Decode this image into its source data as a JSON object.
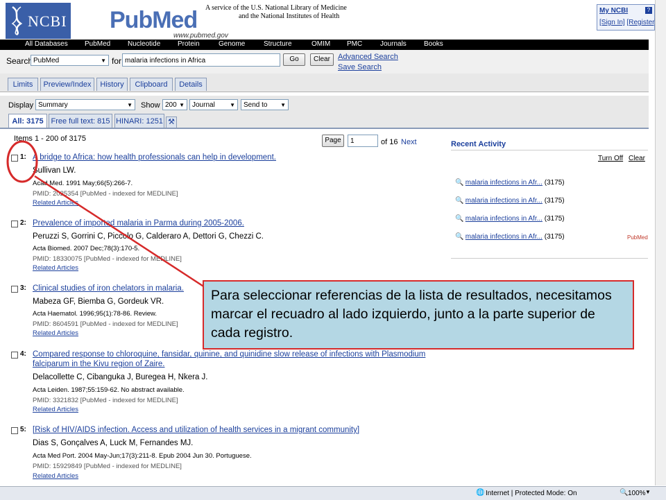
{
  "header": {
    "ncbi_logo_text": "NCBI",
    "pubmed_logo_text": "PubMed",
    "pubmed_url": "www.pubmed.gov",
    "service_line1": "A service of the U.S. National Library of Medicine",
    "service_line2": "and the National Institutes of Health",
    "myncbi_title": "My NCBI",
    "myncbi_help": "?",
    "sign_in": "[Sign In]",
    "register": "[Register]"
  },
  "nav": [
    "All Databases",
    "PubMed",
    "Nucleotide",
    "Protein",
    "Genome",
    "Structure",
    "OMIM",
    "PMC",
    "Journals",
    "Books"
  ],
  "search": {
    "label": "Search",
    "database": "PubMed",
    "for_label": "for",
    "query": "malaria infections in Africa",
    "go": "Go",
    "clear": "Clear",
    "advanced": "Advanced Search",
    "save": "Save Search"
  },
  "tabs": [
    "Limits",
    "Preview/Index",
    "History",
    "Clipboard",
    "Details"
  ],
  "display": {
    "label": "Display",
    "format": "Summary",
    "show_label": "Show",
    "per_page": "200",
    "sort": "Journal",
    "send_to": "Send to"
  },
  "filter_tabs": [
    "All: 3175",
    "Free full text: 815",
    "HINARI: 1251"
  ],
  "pager": {
    "items_text": "Items 1 - 200 of 3175",
    "page_button": "Page",
    "page_value": "1",
    "of_text": "of 16",
    "next": "Next"
  },
  "results": [
    {
      "num": "1:",
      "title": "A bridge to Africa: how health professionals can help in development.",
      "authors": "Sullivan LW.",
      "journal": "Acad Med. 1991 May;66(5):266-7.",
      "pmid": "PMID: 2025354 [PubMed - indexed for MEDLINE]",
      "related": "Related Articles"
    },
    {
      "num": "2:",
      "title": "Prevalence of imported malaria in Parma during 2005-2006.",
      "authors": "Peruzzi S, Gorrini C, Piccolo G, Calderaro A, Dettori G, Chezzi C.",
      "journal": "Acta Biomed. 2007 Dec;78(3):170-5.",
      "pmid": "PMID: 18330075 [PubMed - indexed for MEDLINE]",
      "related": "Related Articles"
    },
    {
      "num": "3:",
      "title": "Clinical studies of iron chelators in malaria.",
      "authors": "Mabeza GF, Biemba G, Gordeuk VR.",
      "journal": "Acta Haematol. 1996;95(1):78-86. Review.",
      "pmid": "PMID: 8604591 [PubMed - indexed for MEDLINE]",
      "related": "Related Articles"
    },
    {
      "num": "4:",
      "title": "Compared response to chloroquine, fansidar, quinine, and quinidine slow release of infections with Plasmodium",
      "title2": "falciparum in the Kivu region of Zaire.",
      "authors": "Delacollette C, Cibanguka J, Buregea H, Nkera J.",
      "journal": "Acta Leiden. 1987;55:159-62. No abstract available.",
      "pmid": "PMID: 3321832 [PubMed - indexed for MEDLINE]",
      "related": "Related Articles"
    },
    {
      "num": "5:",
      "title": "[Risk of HIV/AIDS infection. Access and utilization of health services in a migrant community]",
      "authors": "Dias S, Gonçalves A, Luck M, Fernandes MJ.",
      "journal": "Acta Med Port. 2004 May-Jun;17(3):211-8. Epub 2004 Jun 30. Portuguese.",
      "pmid": "PMID: 15929849 [PubMed - indexed for MEDLINE]",
      "related": "Related Articles"
    }
  ],
  "recent_activity": {
    "title": "Recent Activity",
    "turn_off": "Turn Off",
    "clear": "Clear",
    "items": [
      {
        "query": "malaria infections in Afr...",
        "count": "(3175)",
        "source": ""
      },
      {
        "query": "malaria infections in Afr...",
        "count": "(3175)",
        "source": ""
      },
      {
        "query": "malaria infections in Afr...",
        "count": "(3175)",
        "source": ""
      },
      {
        "query": "malaria infections in Afr...",
        "count": "(3175)",
        "source": "PubMed"
      }
    ]
  },
  "callout_text": "Para seleccionar referencias de la lista de resultados, necesitamos marcar el recuadro al lado izquierdo, junto a la parte superior de cada registro.",
  "statusbar": {
    "zone": "Internet | Protected Mode: On",
    "zoom": "100%"
  },
  "colors": {
    "link": "#1b3f9c",
    "annotation_red": "#d62a2a",
    "callout_bg": "#b4d7e4"
  }
}
